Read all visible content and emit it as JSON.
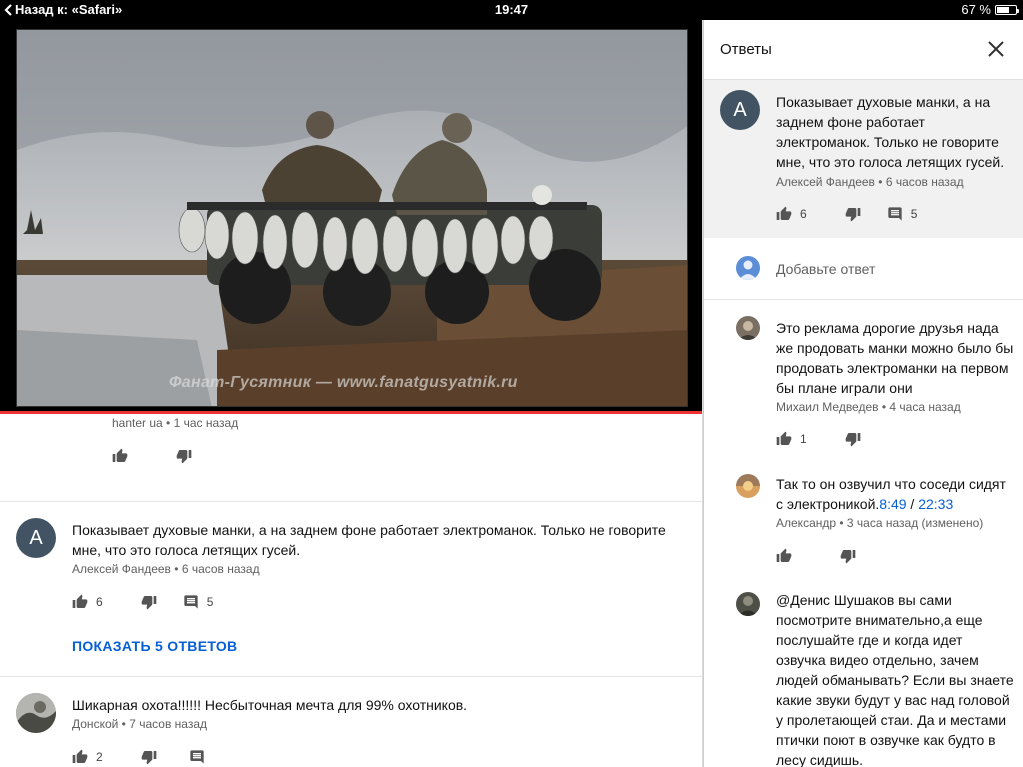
{
  "status_bar": {
    "back_label": "Назад к: «Safari»",
    "time": "19:47",
    "battery": "67 %",
    "battery_level": 0.67
  },
  "video": {
    "watermark": "Фанат-Гусятник — www.fanatgusyatnik.ru",
    "progress": 1.0
  },
  "comments": [
    {
      "author": "hanter ua",
      "time": "1 час назад"
    },
    {
      "avatar_letter": "А",
      "text": "Показывает духовые манки, а на заднем фоне работает электроманок. Только не говорите мне, что это голоса летящих гусей.",
      "author": "Алексей Фандеев",
      "time": "6 часов назад",
      "likes": "6",
      "replies": "5",
      "show_replies": "ПОКАЗАТЬ 5 ОТВЕТОВ"
    },
    {
      "text": "Шикарная охота!!!!!! Несбыточная мечта для 99% охотников.",
      "author": "Донской",
      "time": "7 часов назад",
      "likes": "2"
    }
  ],
  "panel": {
    "title": "Ответы",
    "parent": {
      "avatar_letter": "А",
      "text": "Показывает духовые манки, а на заднем фоне работает электроманок. Только не говорите мне, что это голоса летящих гусей.",
      "author": "Алексей Фандеев",
      "time": "6 часов назад",
      "likes": "6",
      "replies": "5"
    },
    "add_reply_placeholder": "Добавьте ответ",
    "replies": [
      {
        "text": "Это реклама дорогие друзья нада же продовать манки можно было бы продовать электроманки на первом бы плане играли они",
        "author": "Михаил Медведев",
        "time": "4 часа назад",
        "likes": "1"
      },
      {
        "text": "Так то он озвучил что соседи сидят с электроникой.",
        "ts1": "8:49",
        "ts_sep": " / ",
        "ts2": "22:33",
        "author": "Александр",
        "time": "3 часа назад (изменено)"
      },
      {
        "text": "@Денис Шушаков вы сами посмотрите внимательно,а еще послушайте где и когда идет озвучка видео отдельно, зачем людей обманывать? Если вы знаете какие звуки будут у вас над головой у пролетающей стаи. Да и местами птички поют в озвучке как будто в лесу сидишь."
      }
    ]
  },
  "colors": {
    "link": "#065fd4",
    "avatar": "#425463",
    "progress": "#ee3333"
  },
  "icons": [
    "back-chevron-icon",
    "battery-icon",
    "thumb-up-icon",
    "thumb-down-icon",
    "comment-icon",
    "close-icon",
    "user-avatar-icon"
  ]
}
